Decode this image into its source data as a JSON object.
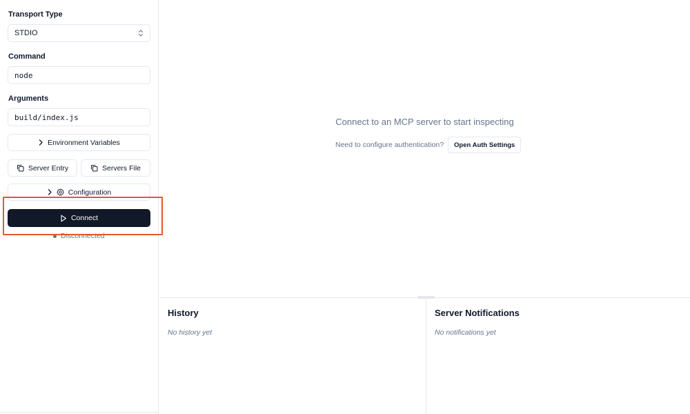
{
  "sidebar": {
    "transport": {
      "label": "Transport Type",
      "value": "STDIO"
    },
    "command": {
      "label": "Command",
      "value": "node"
    },
    "arguments": {
      "label": "Arguments",
      "value": "build/index.js"
    },
    "env_button": "Environment Variables",
    "server_entry_button": "Server Entry",
    "servers_file_button": "Servers File",
    "configuration_button": "Configuration",
    "connect_button": "Connect",
    "status": "Disconnected"
  },
  "main": {
    "empty_title": "Connect to an MCP server to start inspecting",
    "auth_prompt": "Need to configure authentication?",
    "auth_button": "Open Auth Settings"
  },
  "history": {
    "title": "History",
    "empty": "No history yet"
  },
  "notifications": {
    "title": "Server Notifications",
    "empty": "No notifications yet"
  },
  "colors": {
    "primary_button": "#111827",
    "highlight": "#e4572e",
    "muted_text": "#64748b",
    "border": "#e2e8f0"
  },
  "icons": {
    "select": "chevron-up-down-icon",
    "expand": "chevron-right-icon",
    "copy": "copy-icon",
    "settings": "gear-icon",
    "play": "play-icon"
  }
}
